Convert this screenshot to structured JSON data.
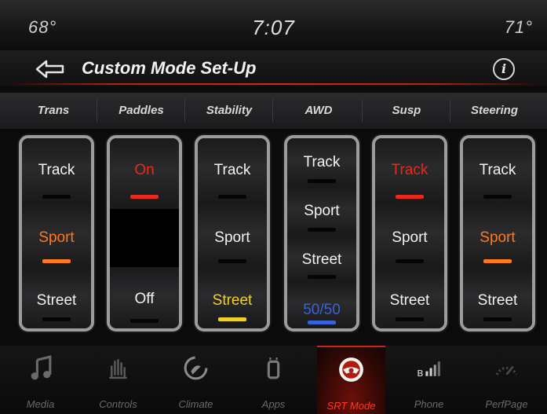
{
  "status": {
    "temp_left": "68°",
    "time": "7:07",
    "temp_right": "71°"
  },
  "header": {
    "title": "Custom Mode Set-Up",
    "info_label": "i"
  },
  "colors": {
    "red": "#e8291b",
    "orange": "#ff7a1a",
    "yellow": "#f0d12a",
    "blue": "#3a62d8",
    "white": "#f2f2f2"
  },
  "columns": [
    {
      "header": "Trans",
      "options": [
        "Track",
        "Sport",
        "Street"
      ],
      "selected": "Sport"
    },
    {
      "header": "Paddles",
      "options": [
        "On",
        "Off"
      ],
      "selected": "On"
    },
    {
      "header": "Stability",
      "options": [
        "Track",
        "Sport",
        "Street"
      ],
      "selected": "Street"
    },
    {
      "header": "AWD",
      "options": [
        "Track",
        "Sport",
        "Street",
        "50/50"
      ],
      "selected": "50/50"
    },
    {
      "header": "Susp",
      "options": [
        "Track",
        "Sport",
        "Street"
      ],
      "selected": "Track"
    },
    {
      "header": "Steering",
      "options": [
        "Track",
        "Sport",
        "Street"
      ],
      "selected": "Sport"
    }
  ],
  "dock": [
    {
      "label": "Media",
      "icon": "music-note-icon"
    },
    {
      "label": "Controls",
      "icon": "controls-hand-icon"
    },
    {
      "label": "Climate",
      "icon": "climate-fan-icon"
    },
    {
      "label": "Apps",
      "icon": "apps-icon"
    },
    {
      "label": "SRT Mode",
      "icon": "steering-wheel-icon",
      "active": true
    },
    {
      "label": "Phone",
      "icon": "phone-signal-icon"
    },
    {
      "label": "PerfPage",
      "icon": "gauge-icon"
    }
  ]
}
